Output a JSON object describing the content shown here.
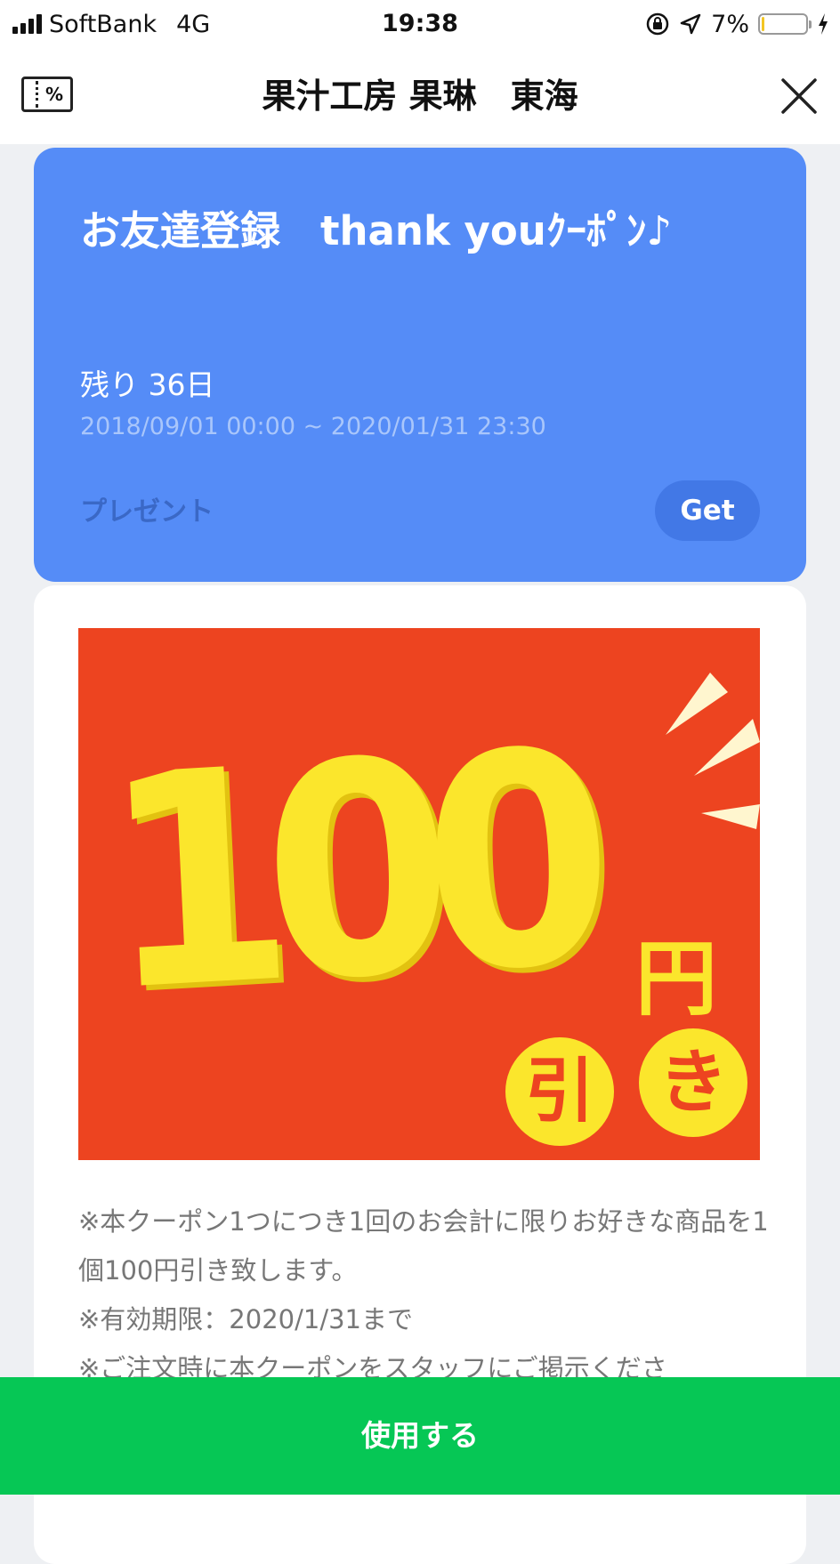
{
  "status_bar": {
    "carrier": "SoftBank",
    "network": "4G",
    "time": "19:38",
    "battery_percent": "7%",
    "battery_level": 0.07,
    "icons": [
      "signal-icon",
      "orientation-lock-icon",
      "location-arrow-icon",
      "battery-icon",
      "charging-icon"
    ]
  },
  "header": {
    "title": "果汁工房 果琳　東海",
    "coupon_list_icon_text": "%",
    "close_icon": "close-icon"
  },
  "coupon": {
    "title": "お友達登録　thank youｸｰﾎﾟﾝ♪",
    "remaining": "残り 36日",
    "period": "2018/09/01 00:00 ~ 2020/01/31 23:30",
    "type": "プレゼント",
    "get_label": "Get",
    "colors": {
      "card": "#558cf7",
      "button": "#4278e6"
    }
  },
  "promo_image": {
    "amount": "100",
    "yen": "円",
    "char1": "引",
    "char2": "き",
    "colors": {
      "background": "#ed4420",
      "text": "#fbe62c"
    }
  },
  "description": "※本クーポン1つにつき1回のお会計に限りお好きな商品を1個100円引き致します。\n※有効期限：2020/1/31まで\n※ご注文時に本クーポンをスタッフにご掲示くださ",
  "footer": {
    "use_label": "使用する",
    "color": "#06c755"
  }
}
